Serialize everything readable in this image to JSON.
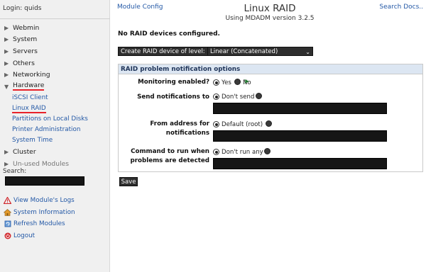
{
  "sidebar": {
    "login": "Login: quids",
    "categories": [
      {
        "label": "Webmin"
      },
      {
        "label": "System"
      },
      {
        "label": "Servers"
      },
      {
        "label": "Others"
      },
      {
        "label": "Networking"
      },
      {
        "label": "Hardware"
      }
    ],
    "hardware_items": [
      {
        "label": "iSCSI Client"
      },
      {
        "label": "Linux RAID"
      },
      {
        "label": "Partitions on Local Disks"
      },
      {
        "label": "Printer Administration"
      },
      {
        "label": "System Time"
      }
    ],
    "categories_after": [
      {
        "label": "Cluster"
      },
      {
        "label": "Un-used Modules"
      }
    ],
    "search_label": "Search:",
    "search_value": "",
    "links": [
      {
        "label": "View Module's Logs",
        "icon": "warning-icon"
      },
      {
        "label": "System Information",
        "icon": "home-icon"
      },
      {
        "label": "Refresh Modules",
        "icon": "refresh-icon"
      },
      {
        "label": "Logout",
        "icon": "power-icon"
      }
    ]
  },
  "header": {
    "module_config": "Module Config",
    "title": "Linux RAID",
    "subtitle": "Using MDADM version 3.2.5",
    "search_docs": "Search Docs.."
  },
  "main": {
    "no_raid": "No RAID devices configured.",
    "create_button": "Create RAID device of level:",
    "create_select": "Linear (Concatenated)",
    "panel_title": "RAID problem notification options",
    "monitoring_label": "Monitoring enabled?",
    "monitoring_yes": "Yes",
    "monitoring_no": "No",
    "send_label": "Send notifications to",
    "send_option": "Don't send",
    "send_value": "",
    "from_label_1": "From address for",
    "from_label_2": "notifications",
    "from_option": "Default (root)",
    "from_value": "",
    "command_label_1": "Command to run when",
    "command_label_2": "problems are detected",
    "command_option": "Don't run any",
    "command_value": "",
    "save_button": "Save"
  },
  "colors": {
    "link": "#2358a6",
    "active_underline": "#e8222a",
    "panel_header": "#dce6f2",
    "dark_control": "#2e2e2e"
  }
}
